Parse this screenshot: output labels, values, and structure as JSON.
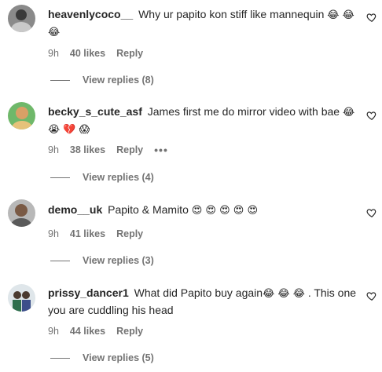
{
  "comments": [
    {
      "username": "heavenlycoco__",
      "text": "Why ur papito kon stiff like mannequin",
      "emojis_inline": "😂 😂",
      "emojis_line2": "😂",
      "time": "9h",
      "likes": "40 likes",
      "reply_label": "Reply",
      "view_replies": "View replies (8)",
      "avatar_icon": "avatar-photo"
    },
    {
      "username": "becky_s_cute_asf",
      "text": "James first me do mirror video with bae",
      "emojis_inline": "😂",
      "emojis_line2": "😭 💔 😱",
      "time": "9h",
      "likes": "38 likes",
      "reply_label": "Reply",
      "more_label": "•••",
      "view_replies": "View replies (4)",
      "avatar_icon": "avatar-photo"
    },
    {
      "username": "demo__uk",
      "text": "Papito & Mamito",
      "emojis_inline": "😍 😍 😍 😍 😍",
      "time": "9h",
      "likes": "41 likes",
      "reply_label": "Reply",
      "view_replies": "View replies (3)",
      "avatar_icon": "avatar-photo"
    },
    {
      "username": "prissy_dancer1",
      "text": "What did Papito buy again",
      "emojis_inline": "😂 😂 😂",
      "text_after": ". This one you are cuddling his head",
      "time": "9h",
      "likes": "44 likes",
      "reply_label": "Reply",
      "view_replies": "View replies (5)",
      "avatar_icon": "avatar-photo"
    }
  ],
  "colors": {
    "text": "#262626",
    "secondary": "#737373",
    "background": "#ffffff"
  },
  "icons": {
    "like": "heart-outline-icon"
  }
}
